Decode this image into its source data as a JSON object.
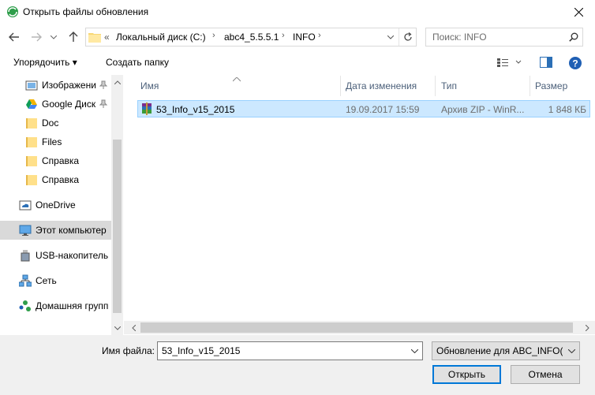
{
  "window": {
    "title": "Открыть файлы обновления"
  },
  "nav": {
    "breadcrumb": [
      "Локальный диск (C:)",
      "abc4_5.5.5.1",
      "INFO"
    ],
    "overflow": "«",
    "search_placeholder": "Поиск: INFO"
  },
  "toolbar": {
    "organize": "Упорядочить ▾",
    "new_folder": "Создать папку"
  },
  "sidebar": {
    "items": [
      {
        "label": "Изображени",
        "icon": "pictures-icon",
        "pinned": true
      },
      {
        "label": "Google Диск",
        "icon": "google-drive-icon",
        "pinned": true
      },
      {
        "label": "Doc",
        "icon": "folder-icon"
      },
      {
        "label": "Files",
        "icon": "folder-icon"
      },
      {
        "label": "Справка",
        "icon": "folder-icon"
      },
      {
        "label": "Справка",
        "icon": "folder-icon"
      },
      {
        "label": "OneDrive",
        "icon": "onedrive-icon"
      },
      {
        "label": "Этот компьютер",
        "icon": "computer-icon",
        "selected": true
      },
      {
        "label": "USB-накопитель",
        "icon": "usb-icon"
      },
      {
        "label": "Сеть",
        "icon": "network-icon"
      },
      {
        "label": "Домашняя групп",
        "icon": "homegroup-icon"
      }
    ]
  },
  "columns": {
    "name": "Имя",
    "date": "Дата изменения",
    "type": "Тип",
    "size": "Размер"
  },
  "files": [
    {
      "name": "53_Info_v15_2015",
      "date": "19.09.2017 15:59",
      "type": "Архив ZIP - WinR...",
      "size": "1 848 КБ",
      "icon": "winrar-archive-icon"
    }
  ],
  "footer": {
    "filename_label": "Имя файла:",
    "filename_value": "53_Info_v15_2015",
    "filetype_value": "Обновление для ABC_INFO(*.z",
    "open_button": "Открыть",
    "cancel_button": "Отмена"
  }
}
